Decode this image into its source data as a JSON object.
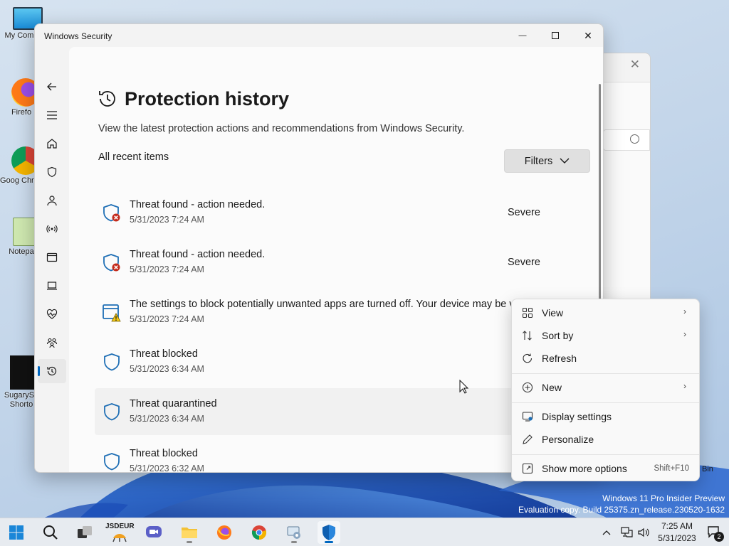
{
  "desktop": {
    "icons": [
      {
        "label": "My Comp",
        "name": "my-computer"
      },
      {
        "label": "Firefo",
        "name": "firefox"
      },
      {
        "label": "Goog Chron",
        "name": "google-chrome"
      },
      {
        "label": "Notepa",
        "name": "notepad"
      },
      {
        "label": "SugarySh Shorto",
        "name": "sugary-shortcut"
      }
    ],
    "recycle_label": "Bin"
  },
  "window": {
    "title": "Windows Security",
    "minimize_glyph": "—",
    "close_glyph": "✕"
  },
  "nav": {
    "items": [
      {
        "name": "back",
        "icon": "back-arrow-icon"
      },
      {
        "name": "menu",
        "icon": "hamburger-menu-icon"
      },
      {
        "name": "home",
        "icon": "home-icon"
      },
      {
        "name": "virus-protection",
        "icon": "shield-icon"
      },
      {
        "name": "account-protection",
        "icon": "person-icon"
      },
      {
        "name": "firewall",
        "icon": "antenna-icon"
      },
      {
        "name": "app-browser-control",
        "icon": "browser-window-icon"
      },
      {
        "name": "device-security",
        "icon": "laptop-icon"
      },
      {
        "name": "device-performance",
        "icon": "heart-pulse-icon"
      },
      {
        "name": "family-options",
        "icon": "family-icon"
      },
      {
        "name": "protection-history",
        "icon": "history-icon"
      },
      {
        "name": "settings",
        "icon": "gear-icon"
      }
    ]
  },
  "page": {
    "title": "Protection history",
    "description": "View the latest protection actions and recommendations from Windows Security.",
    "section_label": "All recent items",
    "filters_label": "Filters"
  },
  "history": [
    {
      "title": "Threat found - action needed.",
      "time": "5/31/2023 7:24 AM",
      "severity": "Severe",
      "icon": "shield-error-icon"
    },
    {
      "title": "Threat found - action needed.",
      "time": "5/31/2023 7:24 AM",
      "severity": "Severe",
      "icon": "shield-error-icon"
    },
    {
      "title": "The settings to block potentially unwanted apps are turned off. Your device may be vu...",
      "time": "5/31/2023 7:24 AM",
      "severity": "",
      "icon": "browser-warning-icon"
    },
    {
      "title": "Threat blocked",
      "time": "5/31/2023 6:34 AM",
      "severity": "",
      "icon": "shield-icon"
    },
    {
      "title": "Threat quarantined",
      "time": "5/31/2023 6:34 AM",
      "severity": "",
      "icon": "shield-icon"
    },
    {
      "title": "Threat blocked",
      "time": "5/31/2023 6:32 AM",
      "severity": "",
      "icon": "shield-icon"
    }
  ],
  "context_menu": {
    "items": [
      {
        "label": "View",
        "icon": "grid-icon",
        "submenu": true,
        "shortcut": ""
      },
      {
        "label": "Sort by",
        "icon": "sort-icon",
        "submenu": true,
        "shortcut": ""
      },
      {
        "label": "Refresh",
        "icon": "refresh-icon",
        "submenu": false,
        "shortcut": ""
      },
      {
        "label": "New",
        "icon": "plus-circle-icon",
        "submenu": true,
        "shortcut": ""
      },
      {
        "label": "Display settings",
        "icon": "display-settings-icon",
        "submenu": false,
        "shortcut": ""
      },
      {
        "label": "Personalize",
        "icon": "pen-icon",
        "submenu": false,
        "shortcut": ""
      },
      {
        "label": "Show more options",
        "icon": "show-more-icon",
        "submenu": false,
        "shortcut": "Shift+F10"
      }
    ],
    "arrow_glyph": "›"
  },
  "watermark": {
    "line1": "Windows 11 Pro Insider Preview",
    "line2": "Evaluation copy. Build 25375.zn_release.230520-1632"
  },
  "taskbar": {
    "apps": [
      {
        "name": "start",
        "icon": "windows-start-icon"
      },
      {
        "name": "search",
        "icon": "search-icon"
      },
      {
        "name": "task-view",
        "icon": "task-view-icon"
      },
      {
        "name": "jsdeur-app",
        "icon": "jsdeur-icon"
      },
      {
        "name": "chat",
        "icon": "chat-icon"
      },
      {
        "name": "file-explorer",
        "icon": "folder-icon"
      },
      {
        "name": "firefox",
        "icon": "firefox-icon"
      },
      {
        "name": "chrome",
        "icon": "chrome-icon"
      },
      {
        "name": "settings-app",
        "icon": "settings-app-icon"
      },
      {
        "name": "windows-security",
        "icon": "windows-security-icon"
      }
    ],
    "badge_label": "JSDEUR",
    "clock_time": "7:25 AM",
    "clock_date": "5/31/2023",
    "notification_count": "2"
  },
  "colors": {
    "accent": "#0067c0",
    "shield_blue": "#1f6fb5",
    "error_red": "#c42b1c",
    "warning_yellow": "#f2c811"
  }
}
